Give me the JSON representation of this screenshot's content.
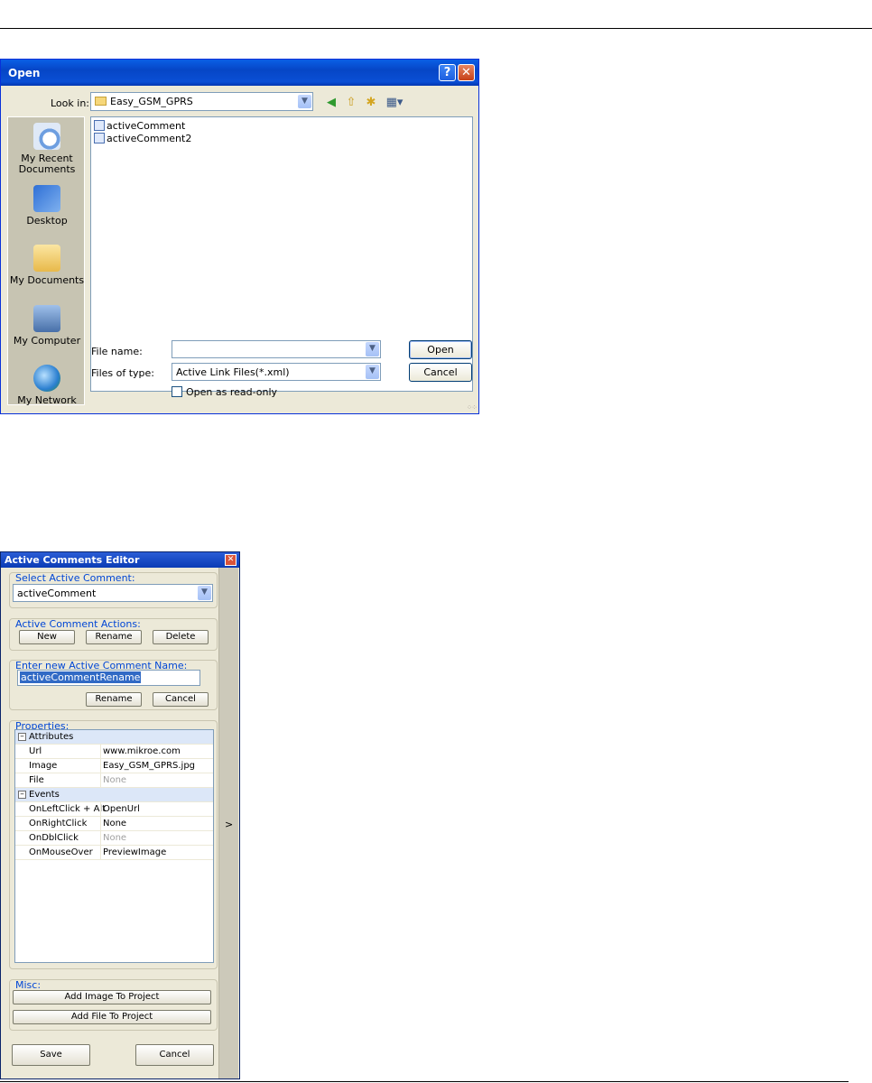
{
  "open_dialog": {
    "title": "Open",
    "help_glyph": "?",
    "close_glyph": "✕",
    "look_in_label": "Look in:",
    "look_in_value": "Easy_GSM_GPRS",
    "places": [
      {
        "label": "My Recent Documents",
        "icon": "recent-documents-icon"
      },
      {
        "label": "Desktop",
        "icon": "desktop-icon"
      },
      {
        "label": "My Documents",
        "icon": "my-documents-icon"
      },
      {
        "label": "My Computer",
        "icon": "my-computer-icon"
      },
      {
        "label": "My Network",
        "icon": "my-network-icon"
      }
    ],
    "files": [
      "activeComment",
      "activeComment2"
    ],
    "file_name_label": "File name:",
    "file_name_value": "",
    "files_of_type_label": "Files of type:",
    "files_of_type_value": "Active Link Files(*.xml)",
    "read_only_label": "Open as read-only",
    "open_button": "Open",
    "cancel_button": "Cancel"
  },
  "editor": {
    "title": "Active Comments Editor",
    "close_glyph": "✕",
    "select_group": "Select Active Comment:",
    "selected_comment": "activeComment",
    "actions_group": "Active Comment Actions:",
    "new_button": "New",
    "rename_button": "Rename",
    "delete_button": "Delete",
    "new_name_group": "Enter new Active Comment Name:",
    "new_name_value": "activeCommentRename",
    "rename_confirm_button": "Rename",
    "rename_cancel_button": "Cancel",
    "properties_group": "Properties:",
    "attributes_category": "Attributes",
    "events_category": "Events",
    "attributes": [
      {
        "key": "Url",
        "value": "www.mikroe.com"
      },
      {
        "key": "Image",
        "value": "Easy_GSM_GPRS.jpg"
      },
      {
        "key": "File",
        "value": "None"
      }
    ],
    "events": [
      {
        "key": "OnLeftClick + Alt",
        "value": "OpenUrl"
      },
      {
        "key": "OnRightClick",
        "value": "None"
      },
      {
        "key": "OnDblClick",
        "value": "None"
      },
      {
        "key": "OnMouseOver",
        "value": "PreviewImage"
      }
    ],
    "misc_group": "Misc:",
    "add_image_button": "Add Image To Project",
    "add_file_button": "Add File  To Project",
    "save_button": "Save",
    "cancel_button": "Cancel",
    "sidebar_arrow": ">"
  }
}
